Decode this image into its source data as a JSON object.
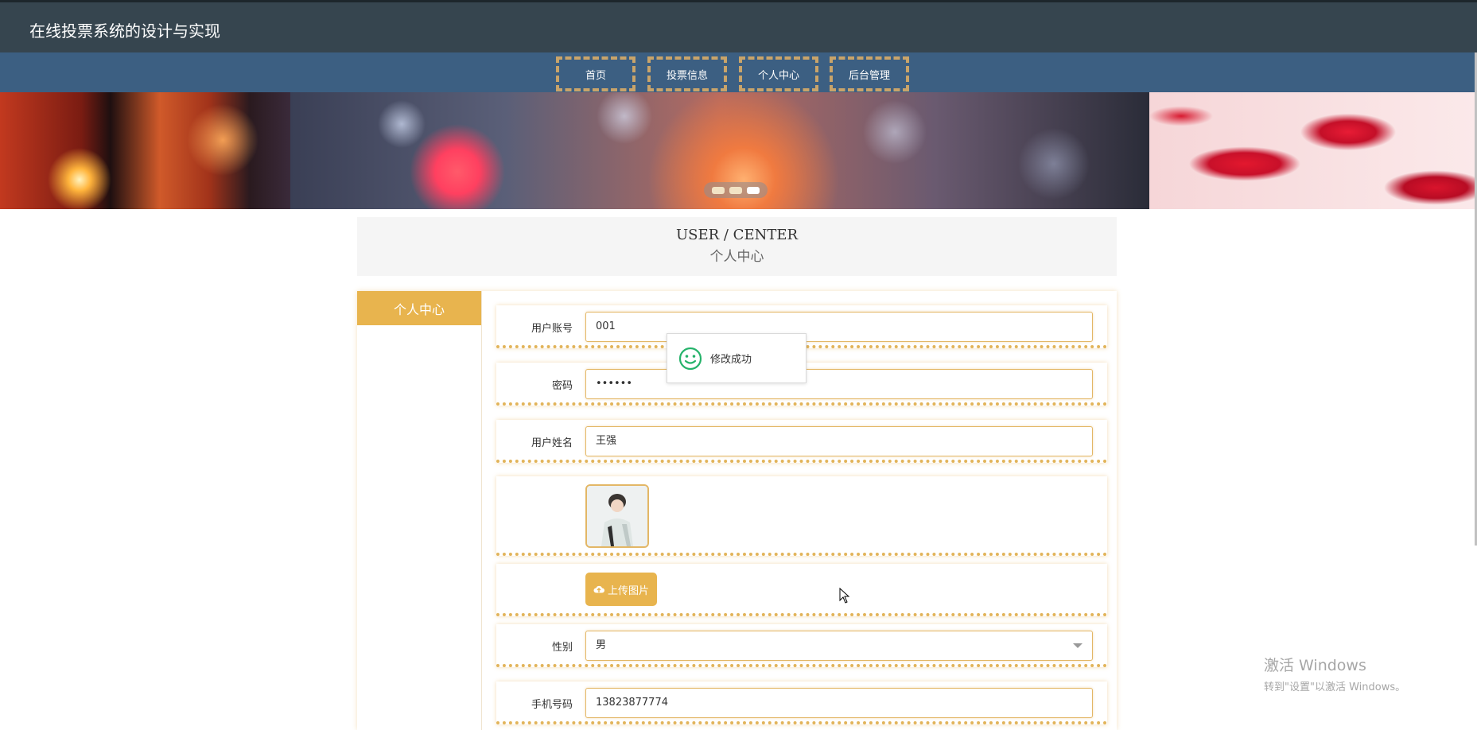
{
  "header": {
    "site_title": "在线投票系统的设计与实现"
  },
  "nav": {
    "items": [
      "首页",
      "投票信息",
      "个人中心",
      "后台管理"
    ]
  },
  "banner": {
    "dot_count": 3,
    "active_dot": 3
  },
  "section": {
    "title_en": "USER / CENTER",
    "title_zh": "个人中心"
  },
  "sidebar": {
    "active_tab": "个人中心"
  },
  "form": {
    "account": {
      "label": "用户账号",
      "value": "001"
    },
    "password": {
      "label": "密码",
      "value": "••••••"
    },
    "name": {
      "label": "用户姓名",
      "value": "王强"
    },
    "upload_label": "上传图片",
    "gender": {
      "label": "性别",
      "value": "男"
    },
    "phone": {
      "label": "手机号码",
      "value": "13823877774"
    }
  },
  "toast": {
    "message": "修改成功",
    "icon": "smile-icon"
  },
  "watermark": {
    "line1": "激活 Windows",
    "line2": "转到\"设置\"以激活 Windows。"
  },
  "colors": {
    "accent": "#e8b44e",
    "topbar": "#36454f",
    "navbar": "#3c5f82",
    "toast_icon": "#26b36b"
  }
}
